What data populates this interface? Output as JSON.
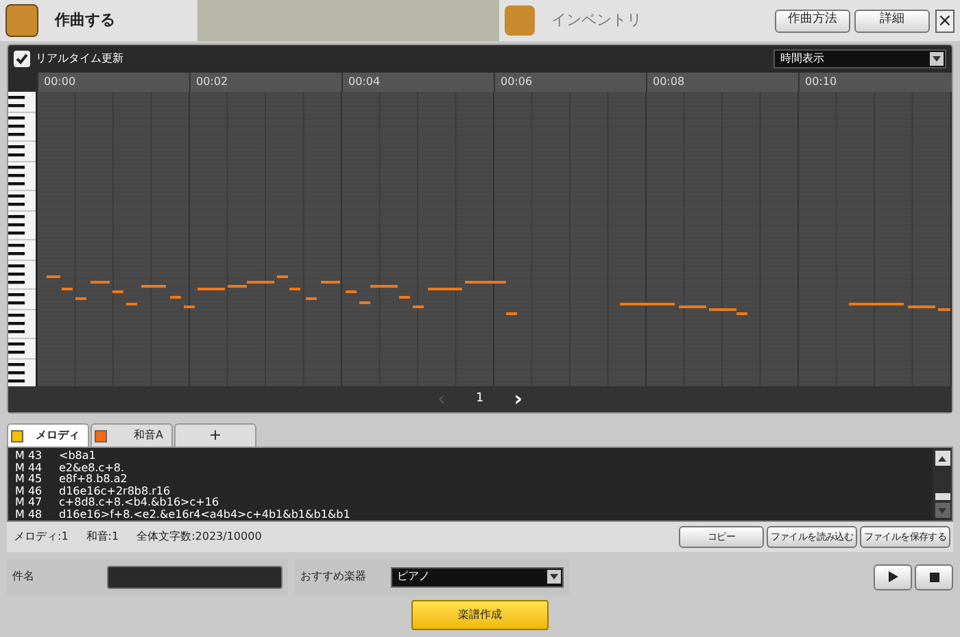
{
  "window": {
    "title": "作曲する",
    "buttons": [
      "作曲方法",
      "詳細"
    ],
    "close": "×"
  },
  "background": {
    "window_title": "インベントリ"
  },
  "toolbar": {
    "realtime": {
      "label": "リアルタイム更新",
      "checked": true
    },
    "view_select": {
      "value": "時間表示"
    }
  },
  "ruler": [
    "00:00",
    "00:02",
    "00:04",
    "00:06",
    "00:08",
    "00:10"
  ],
  "pagination": {
    "prev": "‹",
    "page": "1",
    "next": "›",
    "prev_disabled": true
  },
  "tabs": [
    {
      "label": "メロディ",
      "color": "#f5c000",
      "selected": true,
      "kind": "track"
    },
    {
      "label": "和音A",
      "color": "#f06a1a",
      "selected": false,
      "kind": "track"
    },
    {
      "label": "+",
      "selected": false,
      "kind": "add"
    }
  ],
  "mml_lines": [
    {
      "num": "M 43",
      "code": "<b8a1"
    },
    {
      "num": "M 44",
      "code": "e2&e8.c+8."
    },
    {
      "num": "M 45",
      "code": "e8f+8.b8.a2"
    },
    {
      "num": "M 46",
      "code": "d16e16c+2r8b8.r16"
    },
    {
      "num": "M 47",
      "code": "c+8d8.c+8.<b4.&b16>c+16"
    },
    {
      "num": "M 48",
      "code": "d16e16>f+8.<e2.&e16r4<a4b4>c+4b1&b1&b1&b1"
    }
  ],
  "status": [
    "メロディ:1",
    "和音:1",
    "全体文字数:2023/10000"
  ],
  "file_buttons": [
    "コピー",
    "ファイルを読み込む",
    "ファイルを保存する"
  ],
  "title_field": {
    "label": "件名"
  },
  "instrument": {
    "label": "おすすめ楽器",
    "value": "ピアノ"
  },
  "create_button": "楽譜作成"
}
